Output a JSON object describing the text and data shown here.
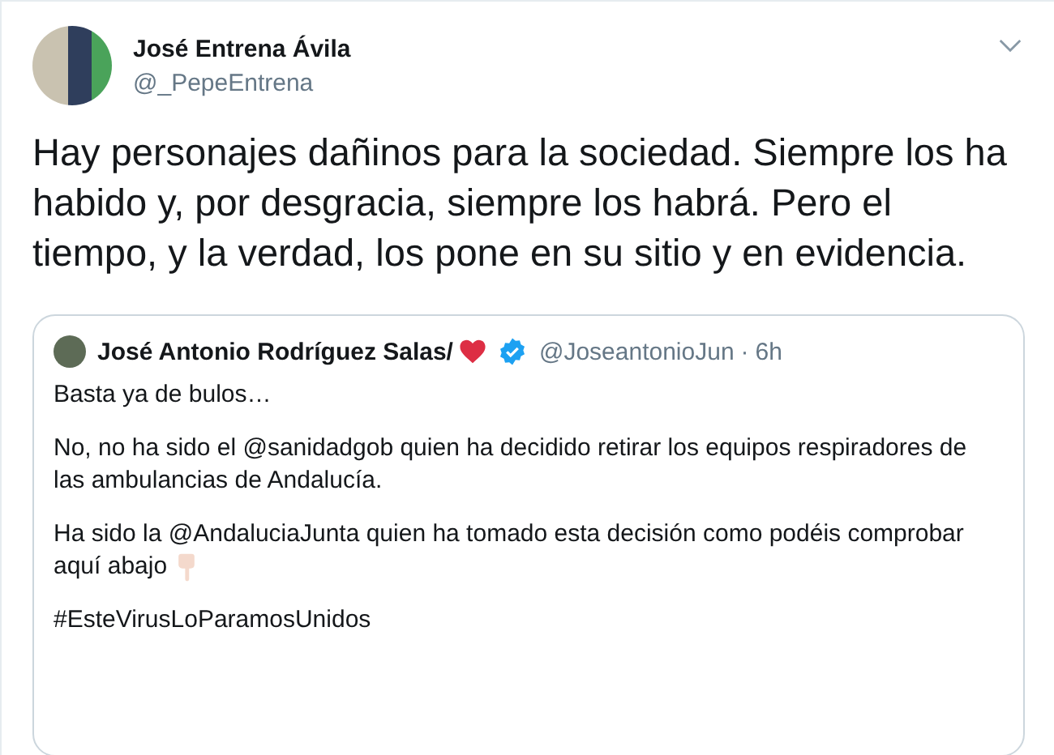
{
  "tweet": {
    "author_name": "José Entrena Ávila",
    "author_handle": "@_PepeEntrena",
    "text": "Hay personajes dañinos para la sociedad. Siempre los ha habido y, por desgracia, siempre los habrá. Pero el tiempo, y la verdad, los pone en su sitio y en evidencia."
  },
  "quoted_tweet": {
    "author_name": "José Antonio Rodríguez Salas/",
    "verified": true,
    "author_handle": "@JoseantonioJun",
    "separator": "·",
    "time": "6h",
    "paragraphs": [
      "Basta ya de bulos…",
      "No, no ha sido el @sanidadgob quien ha decidido retirar los equipos respiradores de las ambulancias de Andalucía.",
      "Ha sido la @AndaluciaJunta quien ha tomado esta decisión como podéis comprobar aquí abajo",
      "#EsteVirusLoParamosUnidos"
    ]
  }
}
